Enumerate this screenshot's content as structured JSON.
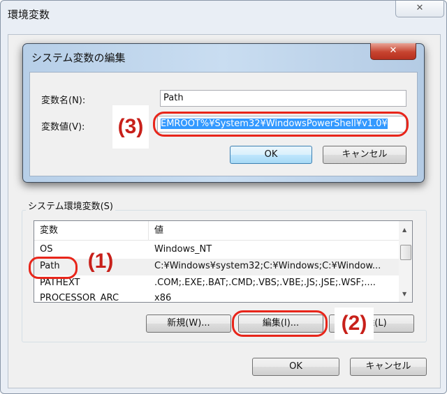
{
  "outer": {
    "title": "環境変数",
    "close_icon": "close-icon"
  },
  "edit_dialog": {
    "title": "システム変数の編集",
    "name_label": "変数名(N):",
    "name_value": "Path",
    "value_label": "変数値(V):",
    "value_value": "EMROOT%¥System32¥WindowsPowerShell¥v1.0¥",
    "ok": "OK",
    "cancel": "キャンセル"
  },
  "system_vars": {
    "group_title": "システム環境変数(S)",
    "columns": [
      "変数",
      "値"
    ],
    "rows": [
      {
        "name": "OS",
        "value": "Windows_NT"
      },
      {
        "name": "Path",
        "value": "C:¥Windows¥system32;C:¥Windows;C:¥Window..."
      },
      {
        "name": "PATHEXT",
        "value": ".COM;.EXE;.BAT;.CMD;.VBS;.VBE;.JS;.JSE;.WSF;...."
      },
      {
        "name": "PROCESSOR_ARC",
        "value": "x86"
      }
    ],
    "selected_row": "Path",
    "new": "新規(W)...",
    "edit": "編集(I)...",
    "delete": "削除(L)"
  },
  "footer": {
    "ok": "OK",
    "cancel": "キャンセル"
  },
  "annotations": {
    "step1": "(1)",
    "step2": "(2)",
    "step3": "(3)",
    "color": "#e8251a"
  }
}
